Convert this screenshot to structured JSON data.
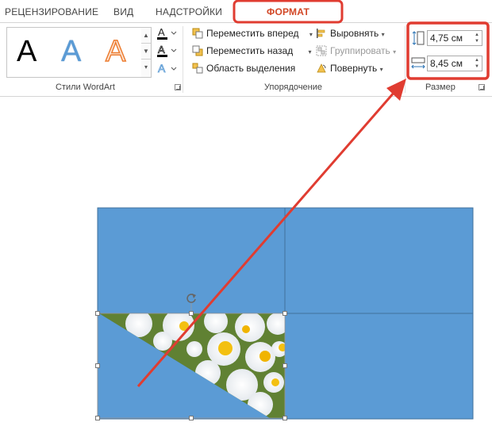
{
  "tabs": [
    {
      "label": "РЕЦЕНЗИРОВАНИЕ"
    },
    {
      "label": "ВИД"
    },
    {
      "label": "НАДСТРОЙКИ"
    },
    {
      "label": "ФОРМАТ",
      "active": true
    }
  ],
  "groups": {
    "wordart": {
      "label": "Стили WordArt",
      "letters": [
        {
          "char": "A",
          "style": "black"
        },
        {
          "char": "A",
          "style": "blue-gradient"
        },
        {
          "char": "A",
          "style": "orange-outline"
        }
      ],
      "buttons": [
        "text-fill-icon",
        "text-outline-icon",
        "text-effects-icon"
      ]
    },
    "arrange": {
      "label": "Упорядочение",
      "bring_forward": "Переместить вперед",
      "send_backward": "Переместить назад",
      "selection_pane": "Область выделения",
      "align": "Выровнять",
      "group": "Группировать",
      "rotate": "Повернуть"
    },
    "size": {
      "label": "Размер",
      "height": "4,75 см",
      "width": "8,45 см"
    }
  },
  "colors": {
    "accent_tab": "#d24726",
    "highlight": "#e03c31",
    "shape_fill": "#5b9bd5",
    "shape_border": "#41719c"
  },
  "canvas": {
    "image_description_icon": "daisies-photo",
    "rotate_handle": "rotate-icon"
  }
}
